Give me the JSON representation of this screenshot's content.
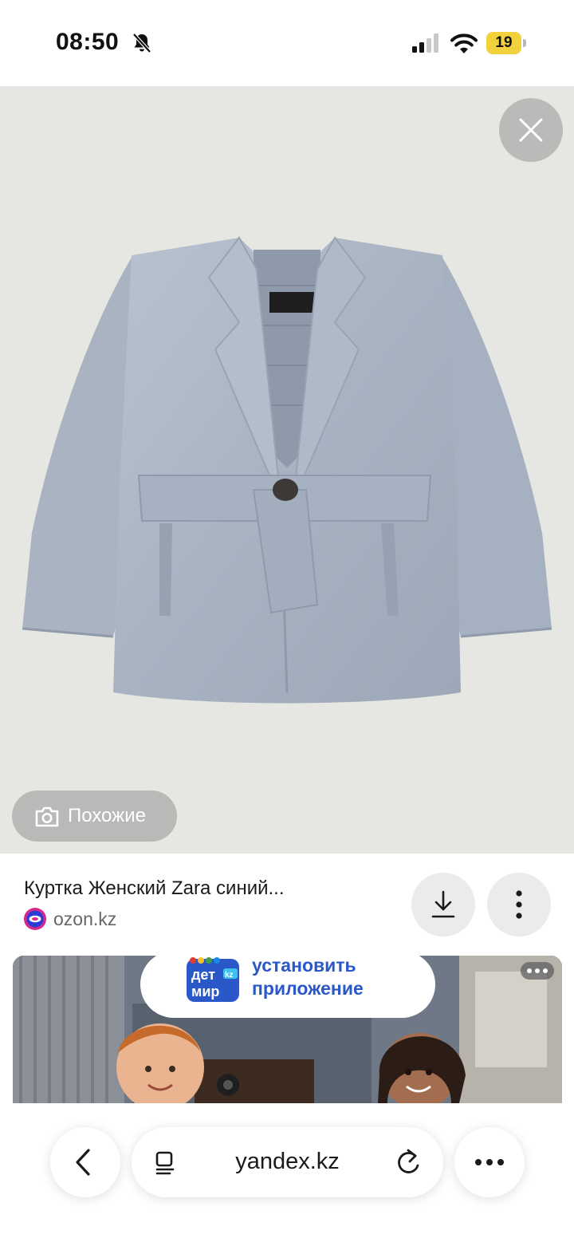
{
  "status_bar": {
    "time": "08:50",
    "battery_level": "19",
    "icons": [
      "bell-slash-icon",
      "cellular-signal-icon",
      "wifi-icon",
      "battery-icon"
    ],
    "battery_color": "#f2d23c"
  },
  "viewer": {
    "image_subject": "jacket-image",
    "close_icon": "close-icon",
    "similar_label": "Похожие",
    "similar_icon": "camera-icon",
    "background_color": "#e6e6e2"
  },
  "result": {
    "title": "Куртка Женский Zara синий...",
    "source_domain": "ozon.kz",
    "source_icon": "ozon-icon",
    "actions": [
      "download-icon",
      "more-vert-icon"
    ]
  },
  "ad": {
    "line1": "установить",
    "line2": "приложение",
    "logo_line1": "дет",
    "logo_line2": "мир",
    "logo_badge": "kz",
    "text_color": "#2a58c8",
    "menu_icon": "more-horiz-icon"
  },
  "browser_bar": {
    "address": "yandex.kz",
    "icons": [
      "back-icon",
      "tabs-icon",
      "reload-icon",
      "more-horiz-icon"
    ]
  }
}
